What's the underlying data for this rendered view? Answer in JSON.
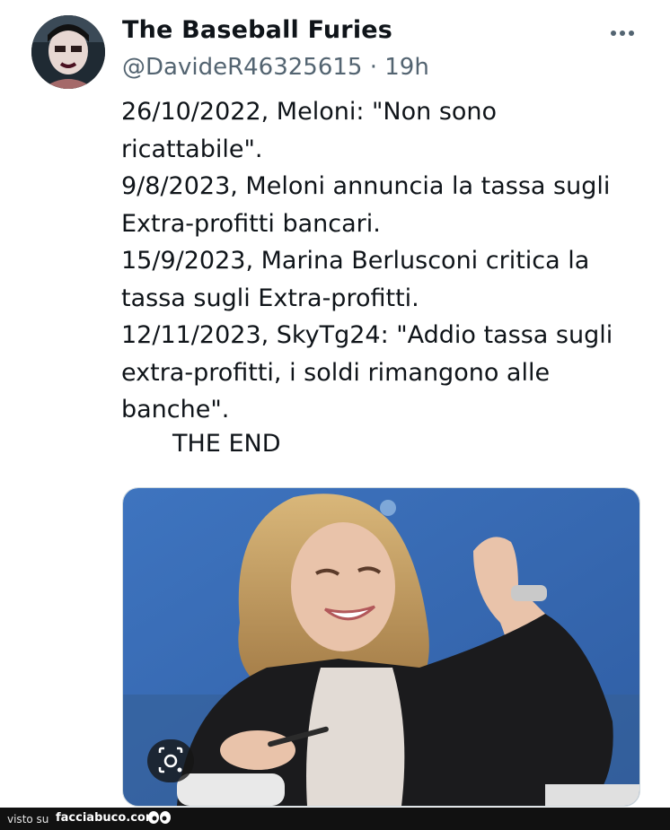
{
  "author": {
    "display_name": "The Baseball Furies",
    "handle": "@DavideR46325615",
    "separator": " · ",
    "time": "19h"
  },
  "tweet": {
    "text": "26/10/2022, Meloni: \"Non sono\nricattabile\".\n9/8/2023, Meloni annuncia la tassa sugli\nExtra-profitti bancari.\n15/9/2023, Marina Berlusconi critica la\ntassa sugli Extra-profitti.\n12/11/2023, SkyTg24: \"Addio tassa sugli\nextra-profitti, i soldi rimangono alle\nbanche\".",
    "ending": "THE END"
  },
  "icons": {
    "more": "more-horizontal-icon",
    "lens": "camera-lens-icon"
  },
  "footer": {
    "visto_su": "visto su",
    "brand": "facciabuco.com"
  },
  "colors": {
    "text": "#0f1419",
    "secondary": "#536471",
    "media_bg": "#3c6fb5",
    "footer_bg": "#111111"
  }
}
